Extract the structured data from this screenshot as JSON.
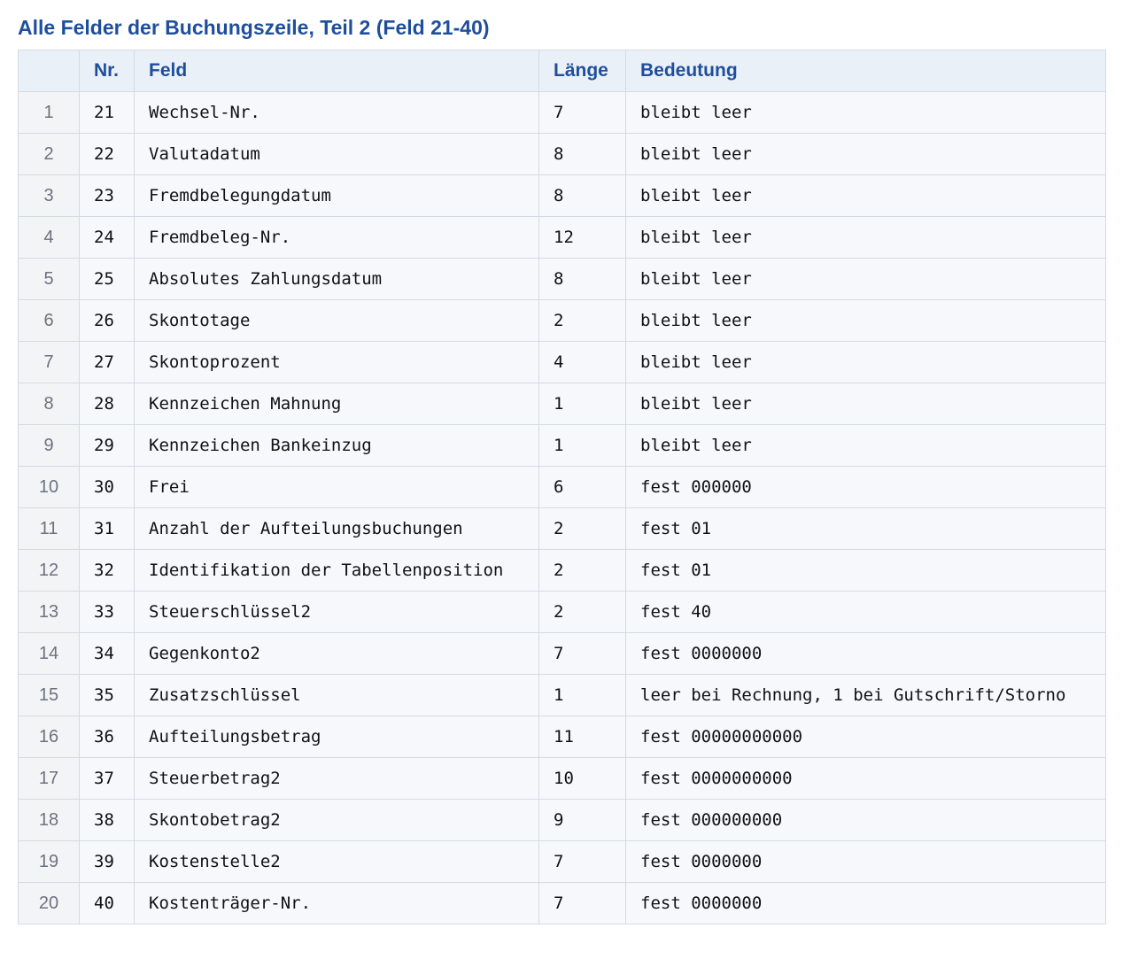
{
  "title": "Alle Felder der Buchungszeile, Teil 2 (Feld 21-40)",
  "table": {
    "columns": [
      "",
      "Nr.",
      "Feld",
      "Länge",
      "Bedeutung"
    ],
    "rows": [
      {
        "index": "1",
        "nr": "21",
        "feld": "Wechsel-Nr.",
        "laenge": "7",
        "bedeutung": "bleibt leer"
      },
      {
        "index": "2",
        "nr": "22",
        "feld": "Valutadatum",
        "laenge": "8",
        "bedeutung": "bleibt leer"
      },
      {
        "index": "3",
        "nr": "23",
        "feld": "Fremdbelegungdatum",
        "laenge": "8",
        "bedeutung": "bleibt leer"
      },
      {
        "index": "4",
        "nr": "24",
        "feld": "Fremdbeleg-Nr.",
        "laenge": "12",
        "bedeutung": "bleibt leer"
      },
      {
        "index": "5",
        "nr": "25",
        "feld": "Absolutes Zahlungsdatum",
        "laenge": "8",
        "bedeutung": "bleibt leer"
      },
      {
        "index": "6",
        "nr": "26",
        "feld": "Skontotage",
        "laenge": "2",
        "bedeutung": "bleibt leer"
      },
      {
        "index": "7",
        "nr": "27",
        "feld": "Skontoprozent",
        "laenge": "4",
        "bedeutung": "bleibt leer"
      },
      {
        "index": "8",
        "nr": "28",
        "feld": "Kennzeichen Mahnung",
        "laenge": "1",
        "bedeutung": "bleibt leer"
      },
      {
        "index": "9",
        "nr": "29",
        "feld": "Kennzeichen Bankeinzug",
        "laenge": "1",
        "bedeutung": "bleibt leer"
      },
      {
        "index": "10",
        "nr": "30",
        "feld": "Frei",
        "laenge": "6",
        "bedeutung": "fest 000000"
      },
      {
        "index": "11",
        "nr": "31",
        "feld": "Anzahl der Aufteilungsbuchungen",
        "laenge": "2",
        "bedeutung": "fest 01"
      },
      {
        "index": "12",
        "nr": "32",
        "feld": "Identifikation der Tabellenposition",
        "laenge": "2",
        "bedeutung": "fest 01"
      },
      {
        "index": "13",
        "nr": "33",
        "feld": "Steuerschlüssel2",
        "laenge": "2",
        "bedeutung": "fest 40"
      },
      {
        "index": "14",
        "nr": "34",
        "feld": "Gegenkonto2",
        "laenge": "7",
        "bedeutung": "fest 0000000"
      },
      {
        "index": "15",
        "nr": "35",
        "feld": "Zusatzschlüssel",
        "laenge": "1",
        "bedeutung": "leer bei Rechnung, 1 bei Gutschrift/Storno"
      },
      {
        "index": "16",
        "nr": "36",
        "feld": "Aufteilungsbetrag",
        "laenge": "11",
        "bedeutung": "fest 00000000000"
      },
      {
        "index": "17",
        "nr": "37",
        "feld": "Steuerbetrag2",
        "laenge": "10",
        "bedeutung": "fest 0000000000"
      },
      {
        "index": "18",
        "nr": "38",
        "feld": "Skontobetrag2",
        "laenge": "9",
        "bedeutung": "fest 000000000"
      },
      {
        "index": "19",
        "nr": "39",
        "feld": "Kostenstelle2",
        "laenge": "7",
        "bedeutung": "fest 0000000"
      },
      {
        "index": "20",
        "nr": "40",
        "feld": "Kostenträger-Nr.",
        "laenge": "7",
        "bedeutung": "fest 0000000"
      }
    ]
  },
  "colors": {
    "title": "#1f4e9c",
    "header_bg": "#eaf0f8",
    "row_bg": "#f6f8fc",
    "border": "#d4dae3"
  }
}
